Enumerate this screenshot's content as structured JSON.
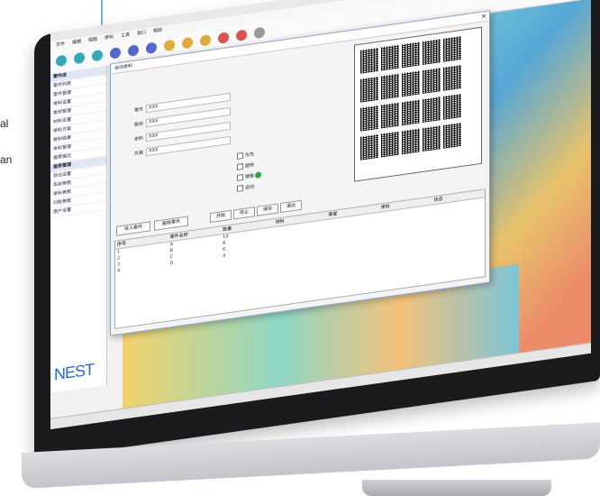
{
  "page": {
    "side_text_1": "al",
    "side_text_2": "an"
  },
  "app": {
    "logo": "NEST",
    "menu": [
      "文件",
      "编辑",
      "视图",
      "排料",
      "工具",
      "窗口",
      "帮助"
    ]
  },
  "sidebar": {
    "items": [
      "零件库",
      "零件列表",
      "零件管理",
      "排料设置",
      "板材管理",
      "材料设置",
      "排料方案",
      "排料结果",
      "余料管理",
      "报表输出",
      "报表管理",
      "导出设置",
      "系统参数",
      "排料参数",
      "切割参数",
      "用户设置"
    ]
  },
  "dialog": {
    "title": "自动排料",
    "fields": [
      {
        "label": "零件",
        "value": "XXX"
      },
      {
        "label": "板材",
        "value": "XXX"
      },
      {
        "label": "余料",
        "value": "XXX"
      },
      {
        "label": "方案",
        "value": "XXX"
      }
    ],
    "checks": [
      "优先",
      "旋转",
      "镜像",
      "自动"
    ],
    "buttons": [
      "开始",
      "停止",
      "保存",
      "退出"
    ],
    "left_buttons": [
      "导入零件",
      "删除零件"
    ],
    "table": {
      "headers": [
        "序号",
        "零件名称",
        "数量",
        "材料",
        "厚度",
        "排料",
        "状态"
      ],
      "rows": [
        [
          "1",
          "A",
          "10",
          "",
          "",
          "",
          ""
        ],
        [
          "2",
          "B",
          "8",
          "",
          "",
          "",
          ""
        ],
        [
          "3",
          "C",
          "6",
          "",
          "",
          "",
          ""
        ],
        [
          "4",
          "D",
          "4",
          "",
          "",
          "",
          ""
        ]
      ]
    }
  },
  "colors": {
    "accent": "#2a6cc4",
    "green": "#2ea44f"
  }
}
